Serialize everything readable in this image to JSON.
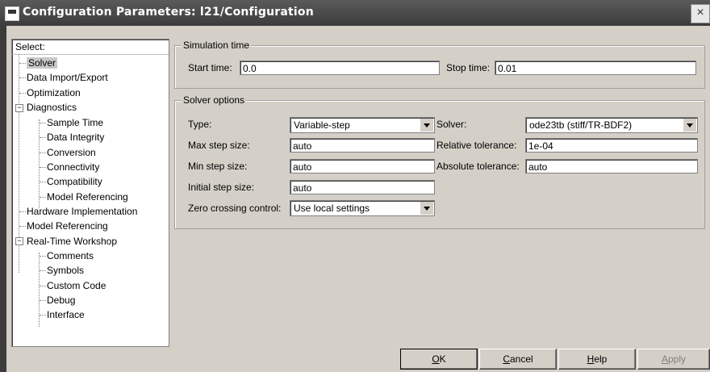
{
  "window": {
    "title": "Configuration Parameters: l21/Configuration",
    "close_glyph": "×"
  },
  "tree": {
    "header": "Select:",
    "items": [
      {
        "label": "Solver",
        "selected": true
      },
      {
        "label": "Data Import/Export"
      },
      {
        "label": "Optimization"
      },
      {
        "label": "Diagnostics",
        "expander": "−"
      },
      {
        "label": "Sample Time"
      },
      {
        "label": "Data Integrity"
      },
      {
        "label": "Conversion"
      },
      {
        "label": "Connectivity"
      },
      {
        "label": "Compatibility"
      },
      {
        "label": "Model Referencing"
      },
      {
        "label": "Hardware Implementation"
      },
      {
        "label": "Model Referencing"
      },
      {
        "label": "Real-Time Workshop",
        "expander": "−"
      },
      {
        "label": "Comments"
      },
      {
        "label": "Symbols"
      },
      {
        "label": "Custom Code"
      },
      {
        "label": "Debug"
      },
      {
        "label": "Interface"
      }
    ]
  },
  "simulation_time": {
    "title": "Simulation time",
    "start_label": "Start time:",
    "start_value": "0.0",
    "stop_label": "Stop time:",
    "stop_value": "0.01"
  },
  "solver_options": {
    "title": "Solver options",
    "type_label": "Type:",
    "type_value": "Variable-step",
    "solver_label": "Solver:",
    "solver_value": "ode23tb (stiff/TR-BDF2)",
    "max_step_label": "Max step size:",
    "max_step_value": "auto",
    "rel_tol_label": "Relative tolerance:",
    "rel_tol_value": "1e-04",
    "min_step_label": "Min step size:",
    "min_step_value": "auto",
    "abs_tol_label": "Absolute tolerance:",
    "abs_tol_value": "auto",
    "init_step_label": "Initial step size:",
    "init_step_value": "auto",
    "zero_cross_label": "Zero crossing control:",
    "zero_cross_value": "Use local settings"
  },
  "buttons": {
    "ok_u": "O",
    "ok_rest": "K",
    "cancel_u": "C",
    "cancel_rest": "ancel",
    "help_u": "H",
    "help_rest": "elp",
    "apply_u": "A",
    "apply_rest": "pply"
  }
}
